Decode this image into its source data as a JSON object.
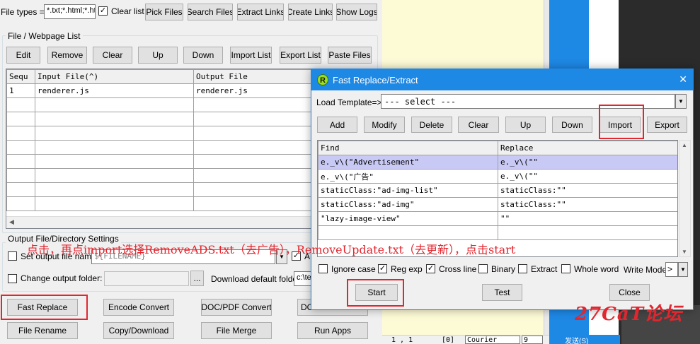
{
  "toolbar": {
    "file_types_label": "File types =>",
    "file_types_value": "*.txt;*.html;*.ht",
    "clear_list_label": "Clear list",
    "pick_files": "Pick Files",
    "search_files": "Search Files",
    "extract_links": "Extract Links",
    "create_links": "Create Links",
    "show_logs": "Show Logs"
  },
  "file_list": {
    "group_label": "File / Webpage List",
    "buttons": {
      "edit": "Edit",
      "remove": "Remove",
      "clear": "Clear",
      "up": "Up",
      "down": "Down",
      "import_list": "Import List",
      "export_list": "Export List",
      "paste_files": "Paste Files"
    },
    "columns": {
      "seq": "Sequ",
      "input": "Input File(^)",
      "output": "Output File"
    },
    "rows": [
      {
        "seq": "1",
        "input": "renderer.js",
        "output": "renderer.js"
      }
    ]
  },
  "output_settings": {
    "group_label": "Output File/Directory Settings",
    "set_output_label": "Set output file name:",
    "output_name_value": "${FILENAME}",
    "change_folder_label": "Change output folder:",
    "browse": "...",
    "download_folder_label": "Download default folder:",
    "download_folder_value": "c:\\te",
    "a_label": "A"
  },
  "bottom_buttons": {
    "fast_replace": "Fast Replace",
    "encode_convert": "Encode Convert",
    "doc_pdf_convert": "DOC/PDF Convert",
    "do_partial": "DO",
    "file_rename": "File Rename",
    "copy_download": "Copy/Download",
    "file_merge": "File Merge",
    "run_apps": "Run Apps"
  },
  "annotation": "点击，再点import选择RemoveADS.txt（去广告），RemoveUpdate.txt（去更新），点击start",
  "watermark": "27CaT论坛",
  "status": {
    "pos": "1 , 1",
    "idx": "[0]",
    "font": "Courier",
    "size": "9",
    "send": "发送(S)"
  },
  "dialog": {
    "title": "Fast Replace/Extract",
    "icon_letter": "R",
    "close_glyph": "✕",
    "load_template_label": "Load Template=>",
    "template_value": "--- select ---",
    "buttons": {
      "add": "Add",
      "modify": "Modify",
      "delete": "Delete",
      "clear": "Clear",
      "up": "Up",
      "down": "Down",
      "import": "Import",
      "export": "Export"
    },
    "columns": {
      "find": "Find",
      "replace": "Replace"
    },
    "rows": [
      {
        "find": "e._v\\(\"Advertisement\"",
        "replace": "e._v\\(\"\""
      },
      {
        "find": "e._v\\(\"广告\"",
        "replace": "e._v\\(\"\""
      },
      {
        "find": "staticClass:\"ad-img-list\"",
        "replace": "staticClass:\"\""
      },
      {
        "find": "staticClass:\"ad-img\"",
        "replace": "staticClass:\"\""
      },
      {
        "find": "\"lazy-image-view\"",
        "replace": "\"\""
      }
    ],
    "options": {
      "ignore_case": "Ignore case",
      "reg_exp": "Reg exp",
      "cross_line": "Cross line",
      "binary": "Binary",
      "extract": "Extract",
      "whole_word": "Whole word"
    },
    "write_mode_label": "Write Mode",
    "write_mode_value": ">",
    "start": "Start",
    "test": "Test",
    "close": "Close"
  },
  "colors": {
    "accent": "#1e88e5",
    "highlight_red": "#e0262f",
    "selected_row": "#c9c9f5",
    "annotation": "#e0262f",
    "note_bg": "#fdfbd6"
  }
}
